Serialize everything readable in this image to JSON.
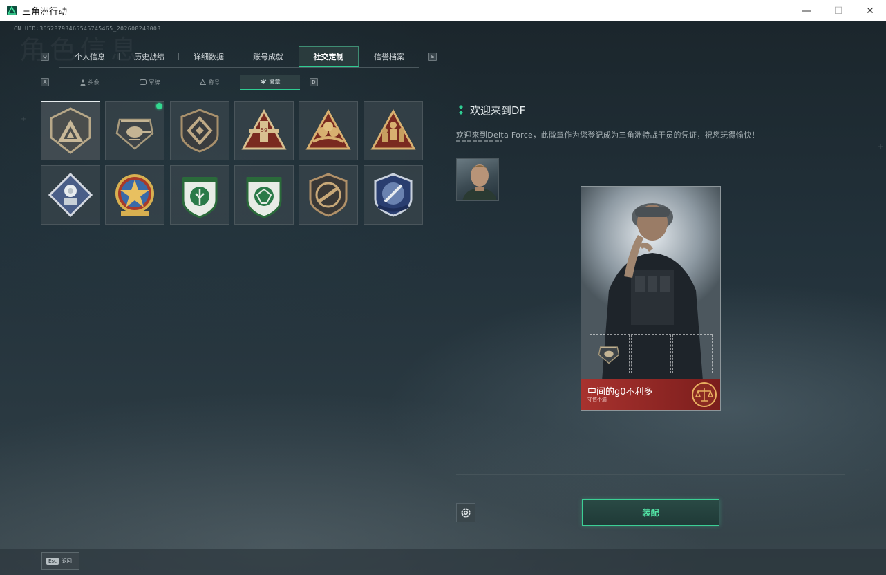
{
  "window": {
    "title": "三角洲行动",
    "min": "—",
    "max": "☐",
    "close": "✕"
  },
  "uid": "CN UID:365287934655457454​65_202608240003",
  "watermark": "角色信息",
  "tabs": {
    "left_key": "Q",
    "right_key": "E",
    "items": [
      {
        "label": "个人信息"
      },
      {
        "label": "历史战绩"
      },
      {
        "label": "详细数据"
      },
      {
        "label": "账号成就"
      },
      {
        "label": "社交定制"
      },
      {
        "label": "信誉档案"
      }
    ],
    "active": 4
  },
  "subtabs": {
    "left_key": "A",
    "right_key": "D",
    "items": [
      {
        "label": "头像",
        "icon": "person-icon"
      },
      {
        "label": "军牌",
        "icon": "tag-icon"
      },
      {
        "label": "称号",
        "icon": "triangle-icon"
      },
      {
        "label": "徽章",
        "icon": "wings-icon"
      }
    ],
    "active": 3
  },
  "badges": {
    "selected": 0,
    "new_index": 1,
    "items": [
      {
        "name": "delta-badge"
      },
      {
        "name": "helicopter-badge"
      },
      {
        "name": "diamond-shield-badge"
      },
      {
        "name": "plane-59-badge"
      },
      {
        "name": "tri-peaks-badge"
      },
      {
        "name": "soldiers-badge"
      },
      {
        "name": "rose-badge"
      },
      {
        "name": "star-badge"
      },
      {
        "name": "green-leaf-badge"
      },
      {
        "name": "green-gem-badge"
      },
      {
        "name": "rifle-badge"
      },
      {
        "name": "blue-sword-badge"
      }
    ]
  },
  "detail": {
    "title": "欢迎来到DF",
    "description": "欢迎来到Delta Force，此徽章作为您登记成为三角洲特战干员的凭证，祝您玩得愉快！"
  },
  "card": {
    "name": "中间的g0不利多",
    "subtitle": "守信不渝"
  },
  "equip_label": "装配",
  "esc": {
    "key": "Esc",
    "label": "返回"
  },
  "colors": {
    "accent": "#2fcc92",
    "card_foot": "#a8322e"
  }
}
